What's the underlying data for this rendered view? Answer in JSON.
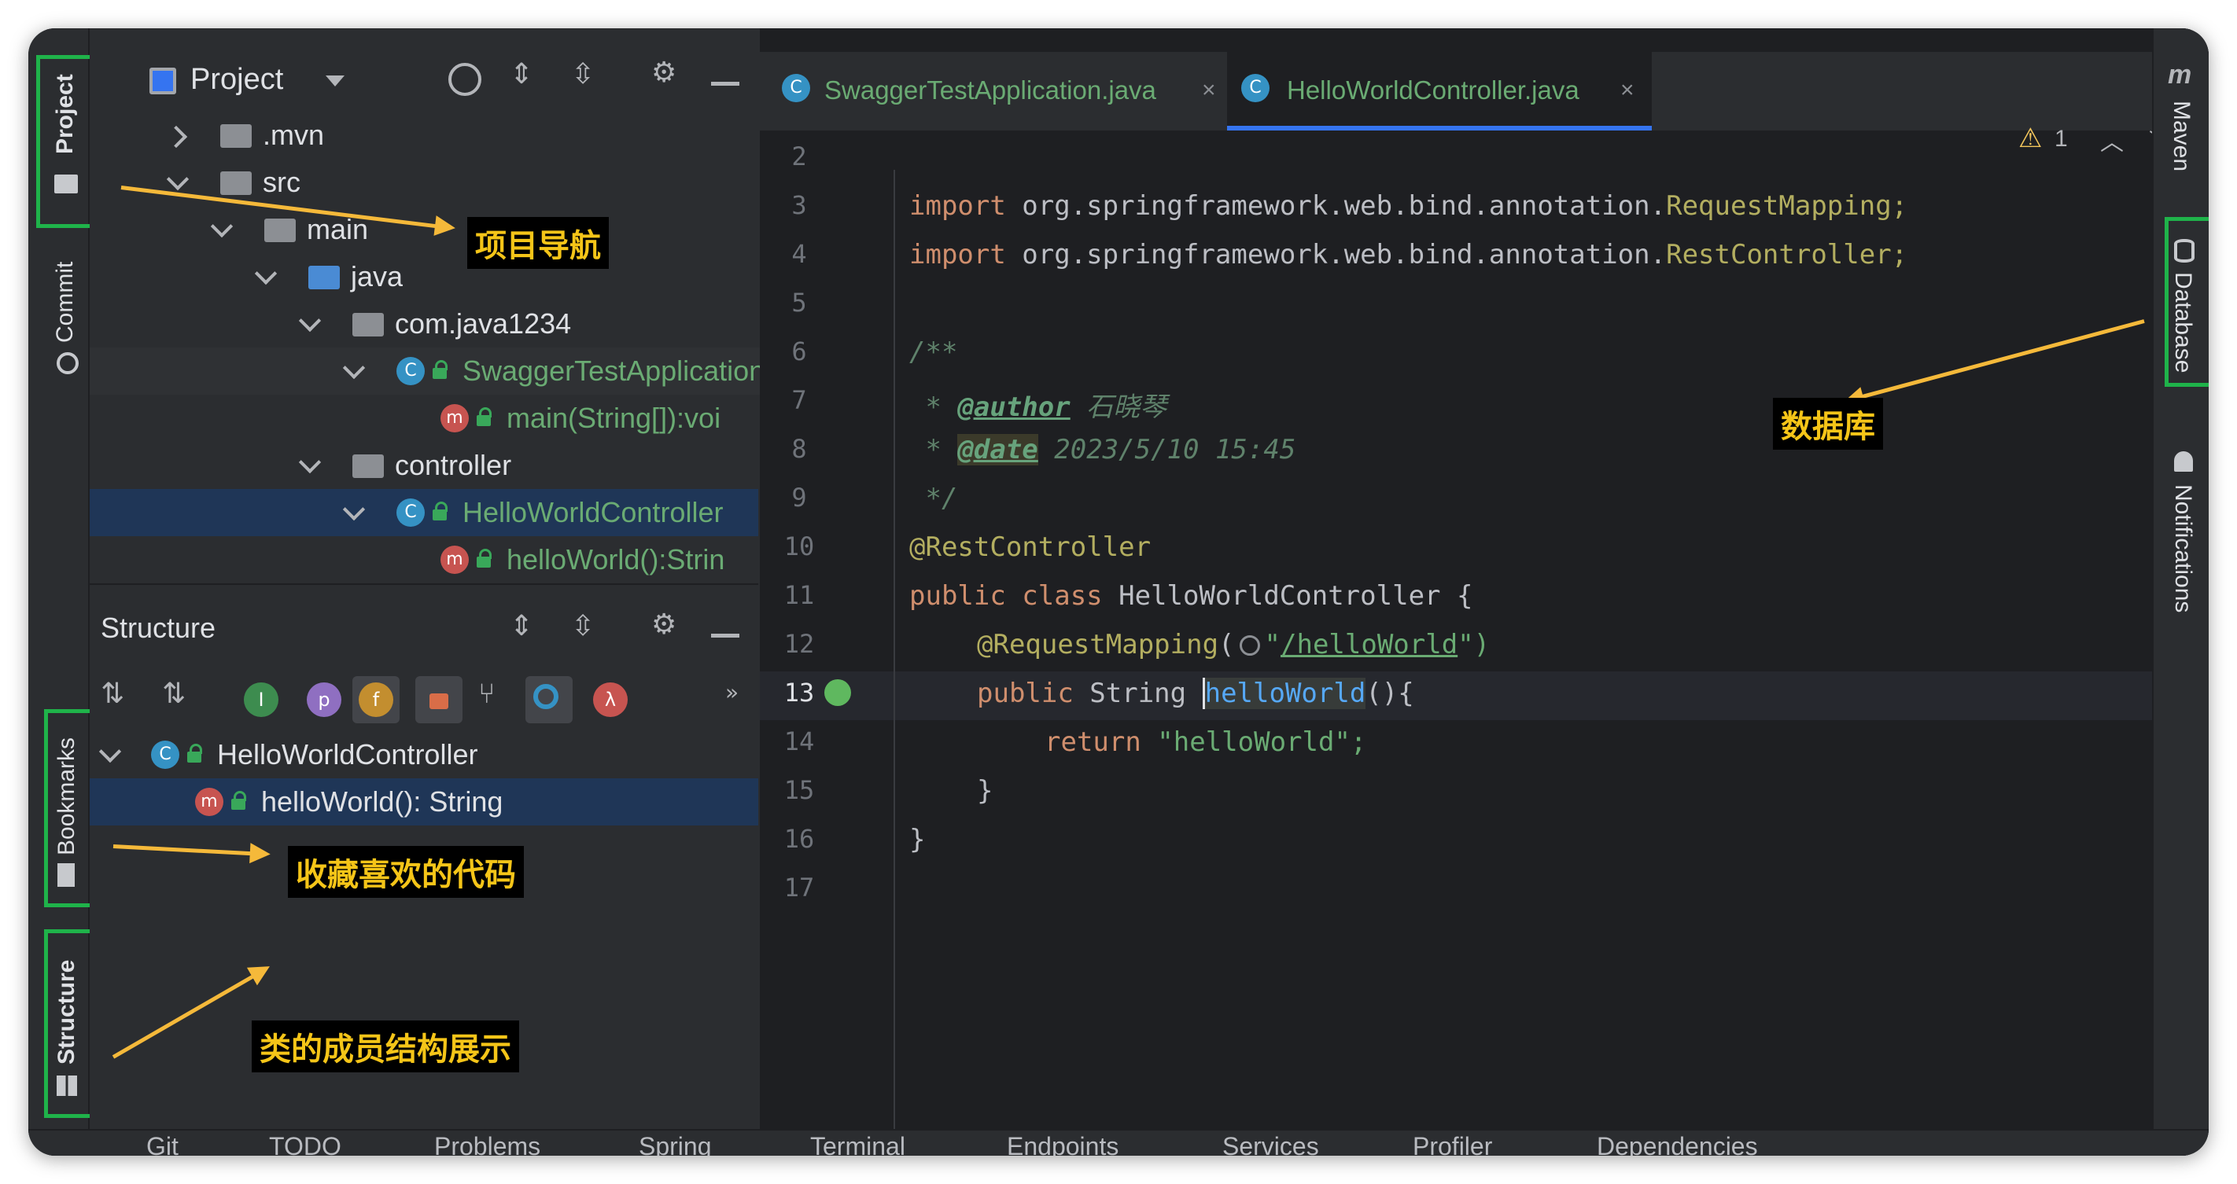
{
  "left_strip": {
    "project": "Project",
    "commit": "Commit",
    "bookmarks": "Bookmarks",
    "structure": "Structure"
  },
  "project_panel": {
    "title": "Project",
    "tree": [
      {
        "label": ".mvn"
      },
      {
        "label": "src"
      },
      {
        "label": "main"
      },
      {
        "label": "java"
      },
      {
        "label": "com.java1234"
      },
      {
        "label": "SwaggerTestApplication"
      },
      {
        "label": "main(String[]):voi"
      },
      {
        "label": "controller"
      },
      {
        "label": "HelloWorldController"
      },
      {
        "label": "helloWorld():Strin"
      }
    ]
  },
  "structure_panel": {
    "title": "Structure",
    "filter_icons": [
      "I",
      "p",
      "f",
      "λ"
    ],
    "tree": [
      {
        "label": "HelloWorldController"
      },
      {
        "label": "helloWorld(): String"
      }
    ]
  },
  "editor": {
    "tabs": [
      {
        "label": "SwaggerTestApplication.java"
      },
      {
        "label": "HelloWorldController.java",
        "active": true
      }
    ],
    "warning_count": "1",
    "line_numbers": [
      "2",
      "3",
      "4",
      "5",
      "6",
      "7",
      "8",
      "9",
      "10",
      "11",
      "12",
      "13",
      "14",
      "15",
      "16",
      "17"
    ],
    "code": {
      "import1_kw": "import",
      "import1_pkg": " org.springframework.web.bind.annotation.",
      "import1_cls": "RequestMapping;",
      "import2_kw": "import",
      "import2_pkg": " org.springframework.web.bind.annotation.",
      "import2_cls": "RestController;",
      "doc_open": "/**",
      "doc_author_prefix": " * ",
      "doc_author_tag": "@author",
      "doc_author_val": " 石晓琴",
      "doc_date_prefix": " * ",
      "doc_date_tag": "@date",
      "doc_date_val": " 2023/5/10 15:45",
      "doc_close": " */",
      "annot_rest": "@RestController",
      "class_kw": "public class",
      "class_name": " HelloWorldController {",
      "annot_req": "@RequestMapping",
      "annot_req_open": "(",
      "annot_req_q1": "\"",
      "annot_req_path": "/helloWorld",
      "annot_req_close": "\")",
      "method_kw": "public",
      "method_type": " String ",
      "method_name": "helloWorld",
      "method_rest": "(){",
      "return_kw": "return",
      "return_val": " \"helloWorld\";",
      "close_method": "}",
      "close_class": "}"
    }
  },
  "right_strip": {
    "maven": "Maven",
    "database": "Database",
    "notifications": "Notifications"
  },
  "bottom_bar": [
    "Git",
    "TODO",
    "Problems",
    "Spring",
    "Terminal",
    "Endpoints",
    "Services",
    "Profiler",
    "Dependencies"
  ],
  "callouts": {
    "project_nav": "项目导航",
    "bookmarks": "收藏喜欢的代码",
    "structure": "类的成员结构展示",
    "database": "数据库"
  },
  "colors": {
    "highlight_green": "#1fb34a",
    "callout_text": "#f5c518",
    "arrow": "#f5b93a"
  }
}
